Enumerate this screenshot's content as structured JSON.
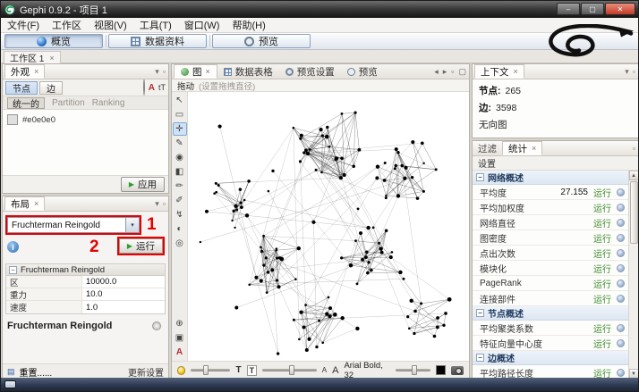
{
  "window": {
    "title": "Gephi 0.9.2 - 项目 1"
  },
  "menu": {
    "items": [
      "文件(F)",
      "工作区",
      "视图(V)",
      "工具(T)",
      "窗口(W)",
      "帮助(H)"
    ]
  },
  "perspective_tabs": {
    "overview": "概览",
    "data_laboratory": "数据资料",
    "preview": "预览"
  },
  "workspace": {
    "tab": "工作区 1"
  },
  "appearance": {
    "title": "外观",
    "nodes_tab": "节点",
    "edges_tab": "边",
    "subtab_unique": "统一的",
    "subtab_partition": "Partition",
    "subtab_ranking": "Ranking",
    "color_hex": "#e0e0e0",
    "apply": "应用"
  },
  "layout": {
    "title": "布局",
    "algorithm": "Fruchterman Reingold",
    "run": "运行",
    "step1": "1",
    "step2": "2",
    "props_header": "Fruchterman Reingold",
    "props": [
      {
        "name": "区",
        "value": "10000.0"
      },
      {
        "name": "重力",
        "value": "10.0"
      },
      {
        "name": "速度",
        "value": "1.0"
      }
    ],
    "selected_algorithm": "Fruchterman Reingold",
    "presets": "重置......",
    "reset": "更新设置"
  },
  "graph": {
    "tab_graph": "图",
    "tab_data_table": "数据表格",
    "tab_preview_settings": "预览设置",
    "tab_preview": "预览",
    "tool_name": "拖动",
    "tool_hint": "(设置拖拽直径)",
    "font_label": "Arial Bold, 32"
  },
  "context": {
    "title": "上下文",
    "nodes_label": "节点:",
    "nodes_value": "265",
    "edges_label": "边:",
    "edges_value": "3598",
    "graph_type": "无向图"
  },
  "filters_stats": {
    "tab_filters": "过滤",
    "tab_statistics": "统计",
    "settings": "设置",
    "run": "运行",
    "sections": [
      {
        "title": "网络概述",
        "items": [
          {
            "label": "平均度",
            "value": "27.155"
          },
          {
            "label": "平均加权度",
            "value": ""
          },
          {
            "label": "网络直径",
            "value": ""
          },
          {
            "label": "图密度",
            "value": ""
          },
          {
            "label": "点出次数",
            "value": ""
          },
          {
            "label": "模块化",
            "value": ""
          },
          {
            "label": "PageRank",
            "value": ""
          },
          {
            "label": "连接部件",
            "value": ""
          }
        ]
      },
      {
        "title": "节点概述",
        "items": [
          {
            "label": "平均聚类系数",
            "value": ""
          },
          {
            "label": "特征向量中心度",
            "value": ""
          }
        ]
      },
      {
        "title": "边概述",
        "items": [
          {
            "label": "平均路径长度",
            "value": ""
          }
        ]
      }
    ]
  },
  "colors": {
    "annotation_red": "#e60000",
    "run_green": "#3c8a28",
    "appearance_swatch": "#e0e0e0"
  },
  "icons": {
    "minimize": "–",
    "maximize": "▢",
    "close": "✕",
    "tab_close": "×",
    "float": "▫",
    "chevron_down": "▾",
    "play": "▶",
    "info": "i",
    "collapse": "−",
    "scroll_up": "▲",
    "scroll_down": "▼",
    "back": "◂",
    "forward": "▸",
    "tools": [
      "↖",
      "▭",
      "✛",
      "✎",
      "◉",
      "◧",
      "✏",
      "✐",
      "↯",
      "◐",
      "◎"
    ],
    "zoom": "⊕",
    "screenshot_small": "▣",
    "attr_a": "A",
    "font_small_a": "A",
    "font_big_a": "A",
    "presets": "▤"
  }
}
